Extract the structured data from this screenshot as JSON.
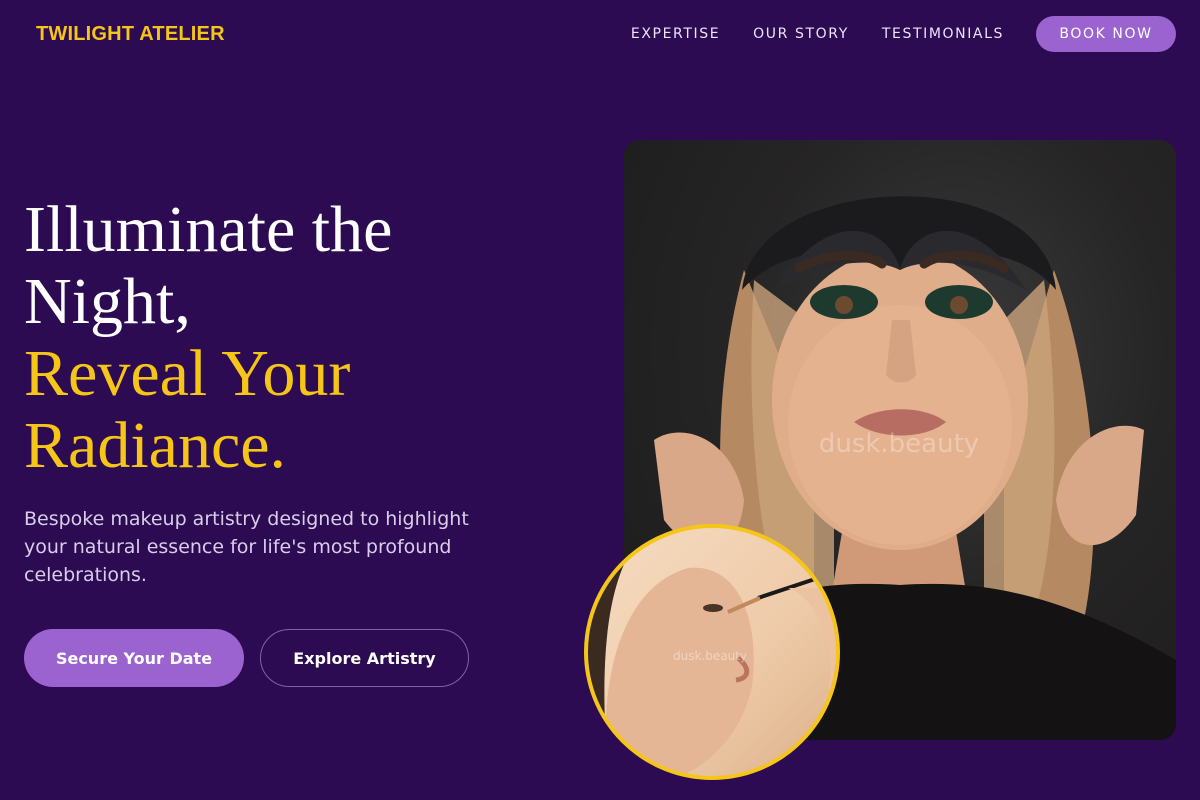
{
  "nav": {
    "logo": "TWILIGHT ATELIER",
    "links": [
      "EXPERTISE",
      "OUR STORY",
      "TESTIMONIALS"
    ],
    "cta": "BOOK NOW"
  },
  "hero": {
    "headline_line1": "Illuminate the",
    "headline_line2": "Night,",
    "headline_line3": "Reveal Your",
    "headline_line4": "Radiance.",
    "subtitle": "Bespoke makeup artistry designed to highlight your natural essence for life's most profound celebrations.",
    "primary_button": "Secure Your Date",
    "secondary_button": "Explore Artistry"
  },
  "images": {
    "main_watermark": "dusk.beauty",
    "circle_watermark": "dusk.beauty"
  },
  "colors": {
    "background": "#2c0b52",
    "accent_gold": "#f5c518",
    "accent_purple": "#9b63d0"
  }
}
